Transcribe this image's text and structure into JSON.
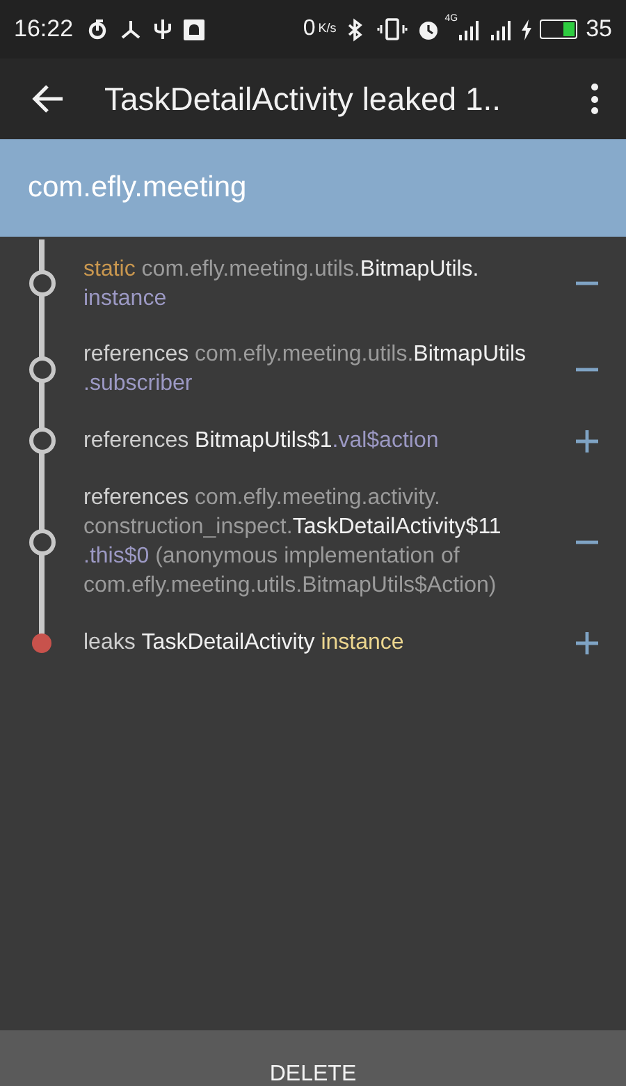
{
  "status_bar": {
    "time": "16:22",
    "speed": "0",
    "speed_unit": "K/s",
    "network_label": "4G",
    "battery": "35"
  },
  "app_bar": {
    "title": "TaskDetailActivity leaked 1.."
  },
  "header": {
    "title": "com.efly.meeting"
  },
  "trace": [
    {
      "kind": "reference",
      "expanded": true,
      "segments": [
        {
          "kind": "keyword",
          "text": "static "
        },
        {
          "kind": "package",
          "text": "com.efly.meeting.utils."
        },
        {
          "kind": "class",
          "text": "BitmapUtils."
        },
        {
          "kind": "field",
          "text": "instance"
        }
      ]
    },
    {
      "kind": "reference",
      "expanded": true,
      "segments": [
        {
          "kind": "plain",
          "text": "references "
        },
        {
          "kind": "package",
          "text": "com.efly.meeting.utils."
        },
        {
          "kind": "class",
          "text": "BitmapUtils"
        },
        {
          "kind": "field",
          "text": ".subscriber"
        }
      ]
    },
    {
      "kind": "reference",
      "expanded": false,
      "segments": [
        {
          "kind": "plain",
          "text": "references "
        },
        {
          "kind": "class",
          "text": "BitmapUtils$1"
        },
        {
          "kind": "field",
          "text": ".val$action"
        }
      ]
    },
    {
      "kind": "reference",
      "expanded": true,
      "segments": [
        {
          "kind": "plain",
          "text": "references "
        },
        {
          "kind": "package",
          "text": "com.efly.meeting.activity."
        },
        {
          "kind": "package",
          "text": "construction_inspect."
        },
        {
          "kind": "class",
          "text": "TaskDetailActivity$11"
        },
        {
          "kind": "field",
          "text": ".this$0"
        },
        {
          "kind": "package",
          "text": " (anonymous implementation of com.efly.meeting.utils."
        },
        {
          "kind": "package",
          "text": "BitmapUtils$Action)"
        }
      ]
    },
    {
      "kind": "leak",
      "expanded": false,
      "segments": [
        {
          "kind": "plain",
          "text": "leaks "
        },
        {
          "kind": "class",
          "text": "TaskDetailActivity "
        },
        {
          "kind": "instance",
          "text": "instance"
        }
      ]
    }
  ],
  "footer": {
    "button": "DELETE"
  }
}
